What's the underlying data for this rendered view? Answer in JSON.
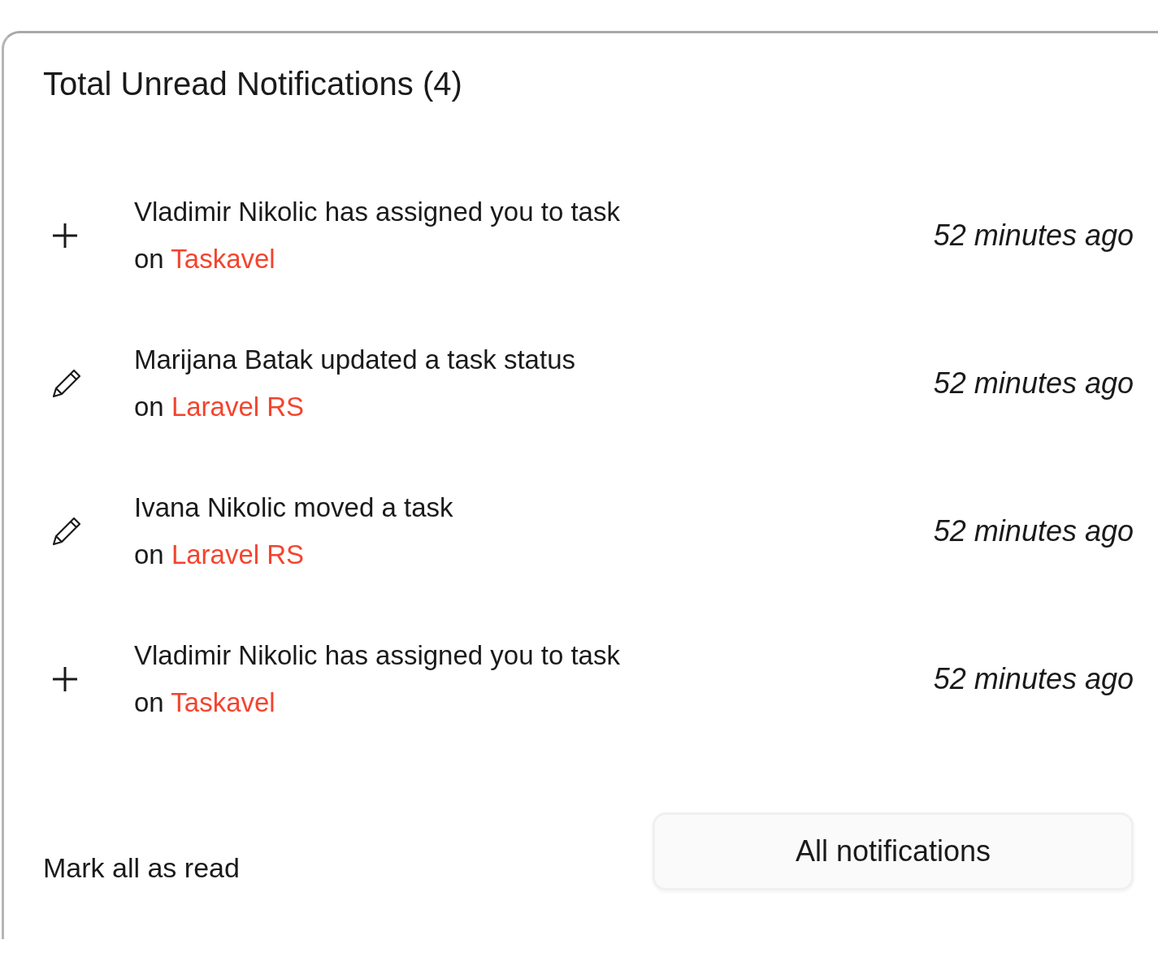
{
  "title": "Total Unread Notifications (4)",
  "notifications": [
    {
      "kind": "add",
      "message": "Vladimir Nikolic has assigned you to task",
      "prefix": "on",
      "project": "Taskavel",
      "time": "52 minutes ago"
    },
    {
      "kind": "edit",
      "message": "Marijana Batak updated a task status",
      "prefix": "on",
      "project": "Laravel RS",
      "time": "52 minutes ago"
    },
    {
      "kind": "edit",
      "message": "Ivana Nikolic moved a task",
      "prefix": "on",
      "project": "Laravel RS",
      "time": "52 minutes ago"
    },
    {
      "kind": "add",
      "message": "Vladimir Nikolic has assigned you to task",
      "prefix": "on",
      "project": "Taskavel",
      "time": "52 minutes ago"
    }
  ],
  "footer": {
    "mark_all": "Mark all as read",
    "all_button": "All notifications"
  }
}
